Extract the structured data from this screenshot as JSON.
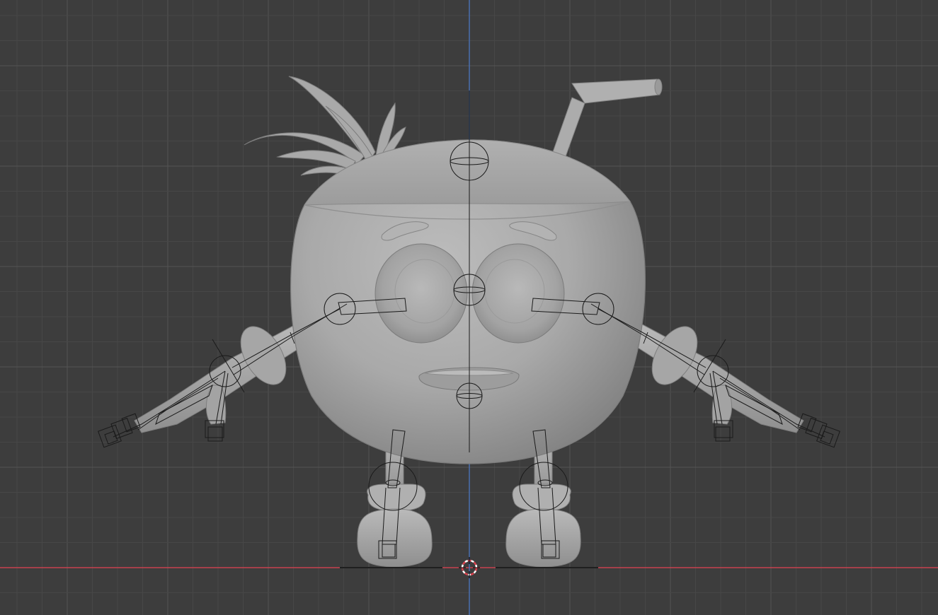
{
  "app": {
    "view": "front-orthographic",
    "mode": "object"
  },
  "viewport": {
    "background": "#3d3d3d",
    "grid": {
      "visible": true,
      "minor_color": "#474747",
      "major_color": "#545454"
    },
    "x_axis_color": "#c8424f",
    "z_axis_color": "#4a6fb0"
  },
  "scene": {
    "character": {
      "kind": "coconut-mascot",
      "material": "clay-gray",
      "parts": [
        "coconut-head",
        "leaf-tuft",
        "drinking-straw",
        "eyes",
        "eyebrows",
        "mouth",
        "left-arm",
        "right-arm",
        "left-leg",
        "right-leg",
        "left-shoe",
        "right-shoe"
      ],
      "base_color": "#a8a8a8"
    },
    "armature": {
      "visible": true,
      "display": "wire",
      "line_color": "#1a1a1a"
    },
    "cursor_3d": {
      "visible": true,
      "icon": "crosshair-icon",
      "colors": [
        "#d9414d",
        "#ffffff"
      ]
    }
  }
}
